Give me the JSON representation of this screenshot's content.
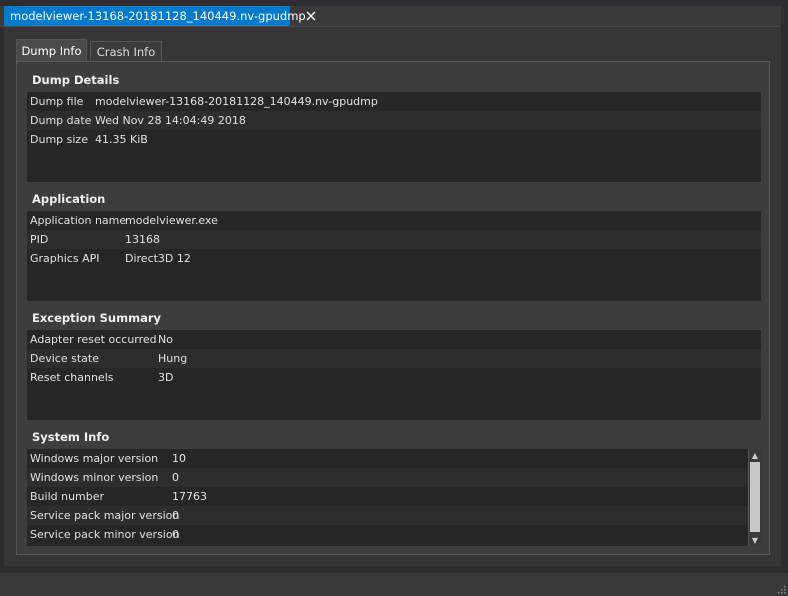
{
  "document_tab": {
    "title": "modelviewer-13168-20181128_140449.nv-gpudmp"
  },
  "tabs": [
    {
      "label": "Dump Info"
    },
    {
      "label": "Crash Info"
    }
  ],
  "groups": {
    "dump_details": {
      "title": "Dump Details",
      "rows": [
        {
          "label": "Dump file",
          "value": "modelviewer-13168-20181128_140449.nv-gpudmp"
        },
        {
          "label": "Dump date",
          "value": "Wed Nov 28 14:04:49 2018"
        },
        {
          "label": "Dump size",
          "value": "41.35 KiB"
        }
      ]
    },
    "application": {
      "title": "Application",
      "rows": [
        {
          "label": "Application name",
          "value": "modelviewer.exe"
        },
        {
          "label": "PID",
          "value": "13168"
        },
        {
          "label": "Graphics API",
          "value": "Direct3D 12"
        }
      ]
    },
    "exception_summary": {
      "title": "Exception Summary",
      "rows": [
        {
          "label": "Adapter reset occurred",
          "value": "No"
        },
        {
          "label": "Device state",
          "value": "Hung"
        },
        {
          "label": "Reset channels",
          "value": "3D"
        }
      ]
    },
    "system_info": {
      "title": "System Info",
      "rows": [
        {
          "label": "Windows major version",
          "value": "10"
        },
        {
          "label": "Windows minor version",
          "value": "0"
        },
        {
          "label": "Build number",
          "value": "17763"
        },
        {
          "label": "Service pack major version",
          "value": "0"
        },
        {
          "label": "Service pack minor version",
          "value": "0"
        }
      ]
    }
  },
  "colors": {
    "accent": "#007acc",
    "background": "#2d2d30",
    "panel": "#3d3d3d",
    "table": "#262626"
  }
}
